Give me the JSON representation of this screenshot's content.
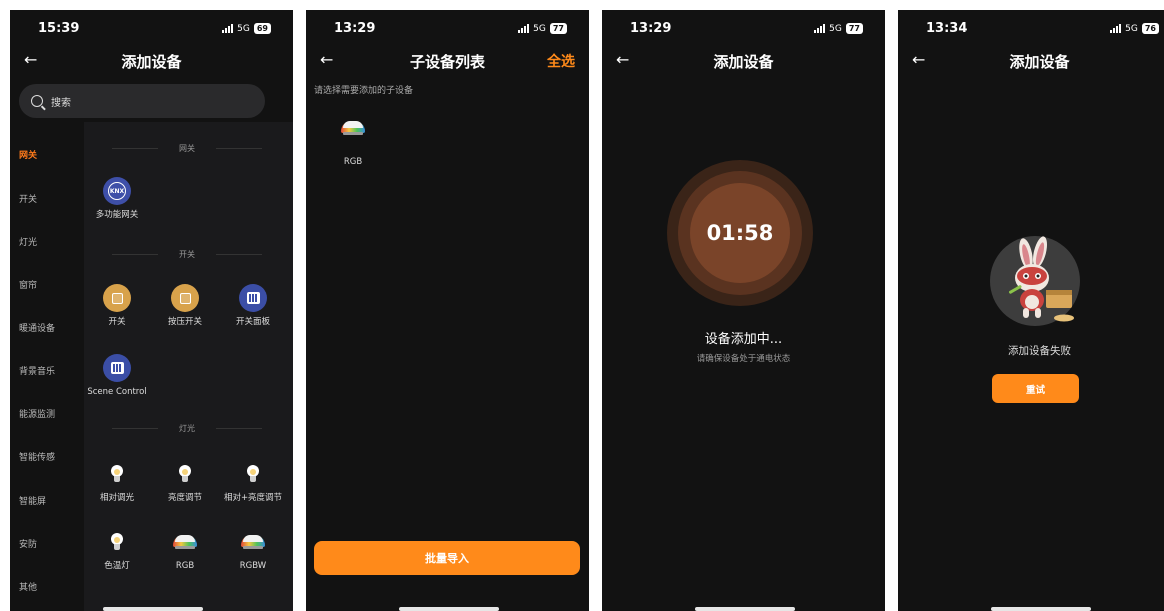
{
  "phones": [
    {
      "time": "15:39",
      "network": "5G",
      "battery": "69",
      "title": "添加设备",
      "search_placeholder": "搜索",
      "categories": [
        "网关",
        "开关",
        "灯光",
        "窗帘",
        "暖通设备",
        "背景音乐",
        "能源监测",
        "智能传感",
        "智能屏",
        "安防",
        "其他"
      ],
      "sections": {
        "gateway": {
          "label": "网关",
          "devices": [
            "多功能网关"
          ]
        },
        "switch": {
          "label": "开关",
          "devices": [
            "开关",
            "按压开关",
            "开关面板",
            "Scene Control"
          ]
        },
        "light": {
          "label": "灯光",
          "devices": [
            "相对调光",
            "亮度调节",
            "相对+亮度调节",
            "色温灯",
            "RGB",
            "RGBW"
          ]
        }
      }
    },
    {
      "time": "13:29",
      "network": "5G",
      "battery": "77",
      "title": "子设备列表",
      "select_all": "全选",
      "hint": "请选择需要添加的子设备",
      "sub_device": "RGB",
      "import_button": "批量导入"
    },
    {
      "time": "13:29",
      "network": "5G",
      "battery": "77",
      "title": "添加设备",
      "timer": "01:58",
      "status": "设备添加中...",
      "status_sub": "请确保设备处于通电状态"
    },
    {
      "time": "13:34",
      "network": "5G",
      "battery": "76",
      "title": "添加设备",
      "fail": "添加设备失败",
      "retry": "重试"
    }
  ],
  "icons": {
    "back": "arrow-left-icon",
    "search": "search-icon",
    "gateway": "knx-icon",
    "switch": "switch-square-icon",
    "panel": "switch-panel-icon",
    "bulb": "bulb-icon",
    "rgb": "rgb-dome-light-icon"
  },
  "colors": {
    "accent": "#ff8a1a",
    "background": "#121212",
    "knx_blue": "#3e4fa8",
    "switch_gold": "#d8a24b"
  }
}
